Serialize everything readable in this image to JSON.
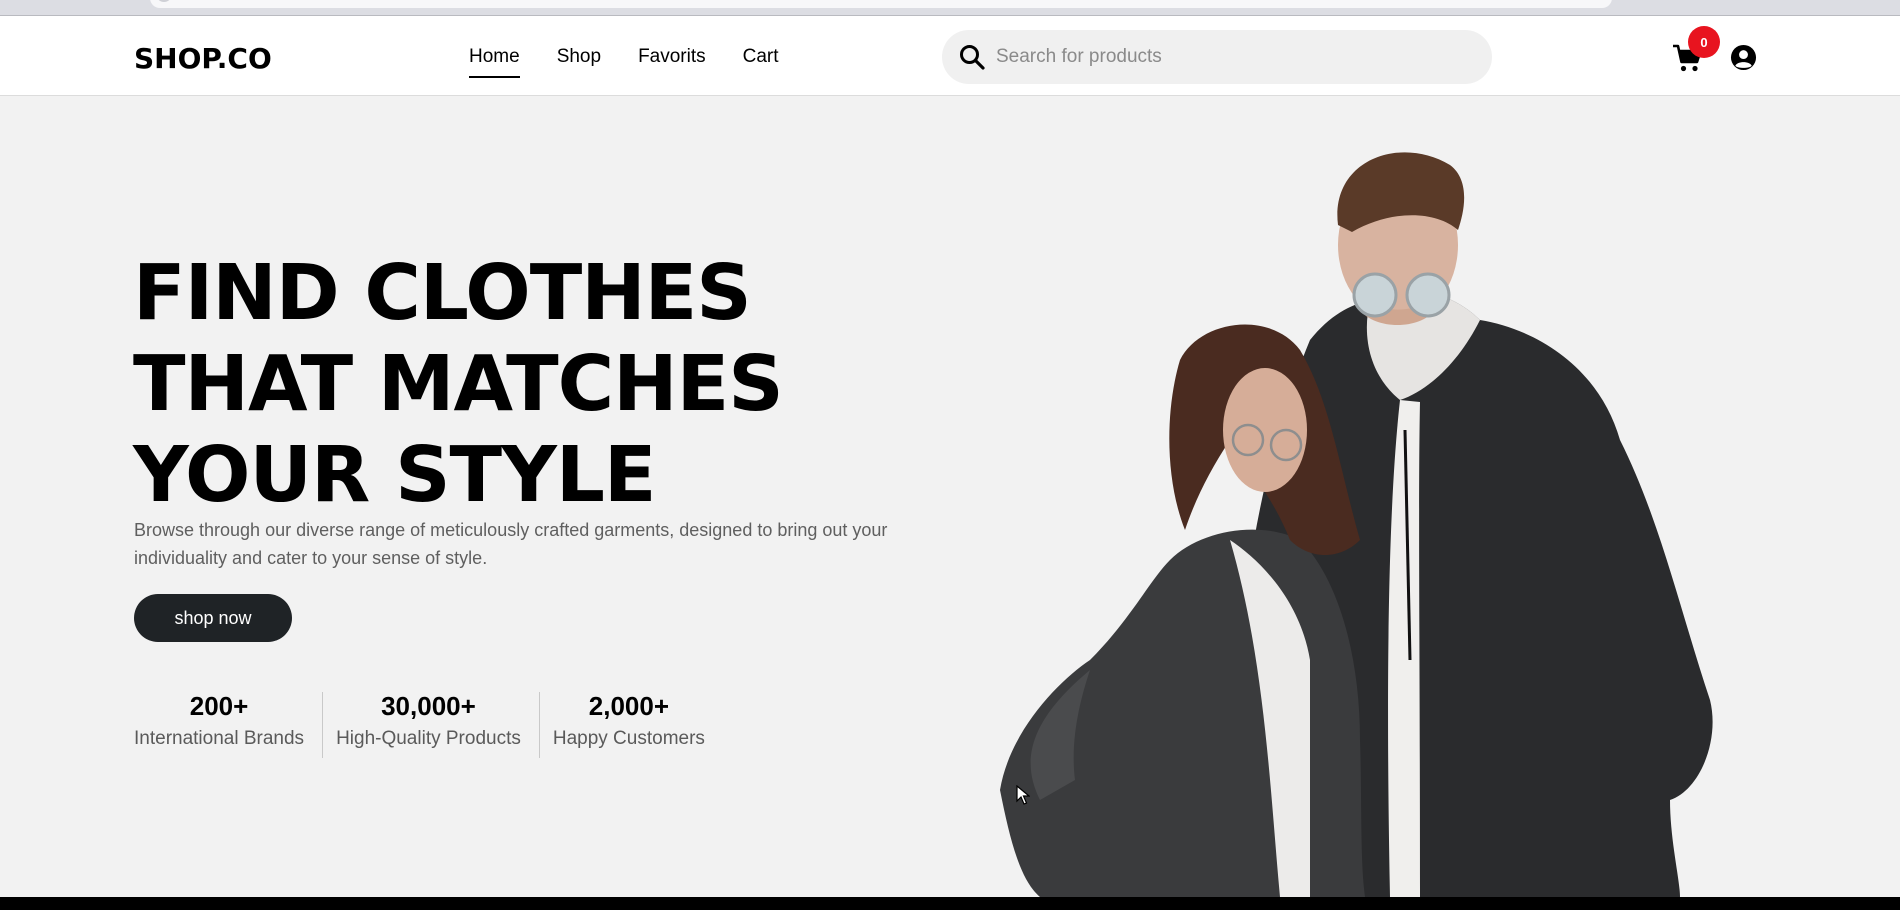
{
  "header": {
    "logo": "SHOP.CO",
    "nav": {
      "home": "Home",
      "shop": "Shop",
      "favorites": "Favorits",
      "cart": "Cart"
    },
    "search": {
      "placeholder": "Search for products",
      "value": ""
    },
    "cart_count": "0",
    "icons": {
      "search": "search-icon",
      "cart": "cart-icon",
      "profile": "user-circle-icon"
    }
  },
  "hero": {
    "title_lines": [
      "FIND CLOTHES",
      "THAT MATCHES",
      "YOUR STYLE"
    ],
    "description": "Browse through our diverse range of meticulously crafted garments, designed to bring out your individuality and cater to your sense of style.",
    "cta": "shop now",
    "stats": [
      {
        "value": "200+",
        "label": "International Brands"
      },
      {
        "value": "30,000+",
        "label": "High-Quality Products"
      },
      {
        "value": "2,000+",
        "label": "Happy Customers"
      }
    ]
  },
  "colors": {
    "background": "#f2f2f2",
    "button": "#1f2326",
    "badge": "#e8141f"
  }
}
